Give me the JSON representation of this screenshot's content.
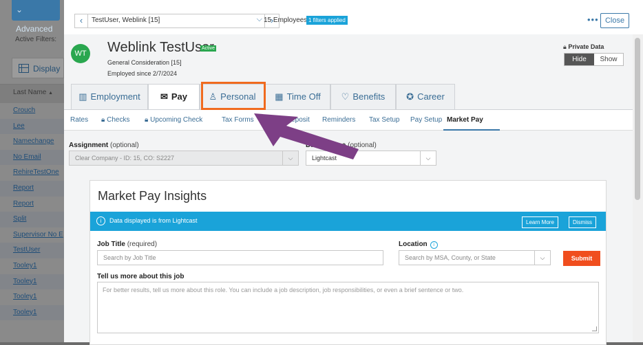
{
  "sidebar": {
    "advanced_label": "Advanced",
    "active_filters_label": "Active Filters:",
    "display_label": "Display",
    "last_name_header": "Last Name",
    "names": [
      "Crouch",
      "Lee",
      "Namechange",
      "No Email",
      "RehireTestOne",
      "Report",
      "Report",
      "Split",
      "Supervisor No E",
      "TestUser",
      "Tooley1",
      "Tooley1",
      "Tooley1",
      "Tooley1"
    ]
  },
  "topbar": {
    "employee_selector": "TestUser, Weblink [15]",
    "employee_count": "15 Employees",
    "filters_badge": "1 filters applied",
    "more_label": "•••",
    "close_label": "Close"
  },
  "employee": {
    "initials": "WT",
    "name": "Weblink TestUser",
    "status": "Active",
    "group": "General Consideration [15]",
    "employed_since": "Employed since 2/7/2024",
    "private_data_label": "Private Data",
    "hide_label": "Hide",
    "show_label": "Show"
  },
  "tabs": [
    {
      "label": "Employment",
      "icon": "building-icon"
    },
    {
      "label": "Pay",
      "icon": "money-icon"
    },
    {
      "label": "Personal",
      "icon": "person-icon"
    },
    {
      "label": "Time Off",
      "icon": "calendar-icon"
    },
    {
      "label": "Benefits",
      "icon": "heart-icon"
    },
    {
      "label": "Career",
      "icon": "badge-icon"
    }
  ],
  "subnav": [
    "Rates",
    "Checks",
    "Upcoming Check",
    "Tax Forms",
    "Direct Deposit",
    "Reminders",
    "Tax Setup",
    "Pay Setup",
    "Market Pay"
  ],
  "form": {
    "assignment_label": "Assignment",
    "assignment_optional": "(optional)",
    "assignment_value": "Clear Company - ID: 15, CO: S2227",
    "data_source_label": "Data Source",
    "data_source_optional": "(optional)",
    "data_source_value": "Lightcast"
  },
  "market_pay": {
    "title": "Market Pay Insights",
    "info_text": "Data displayed is from Lightcast",
    "learn_more": "Learn More",
    "dismiss": "Dismiss",
    "job_title_label": "Job Title",
    "job_title_required": "(required)",
    "job_title_placeholder": "Search by Job Title",
    "location_label": "Location",
    "location_placeholder": "Search by MSA, County, or State",
    "submit_label": "Submit",
    "tell_us_label": "Tell us more about this job",
    "tell_us_placeholder": "For better results, tell us more about this role. You can include a job description, job responsibilities, or even a brief sentence or two."
  },
  "colors": {
    "accent": "#1aa3d9",
    "active_green": "#2aa74f",
    "highlight_orange": "#f06a1e",
    "arrow_purple": "#7d3f86",
    "submit_orange": "#f04e1e"
  }
}
